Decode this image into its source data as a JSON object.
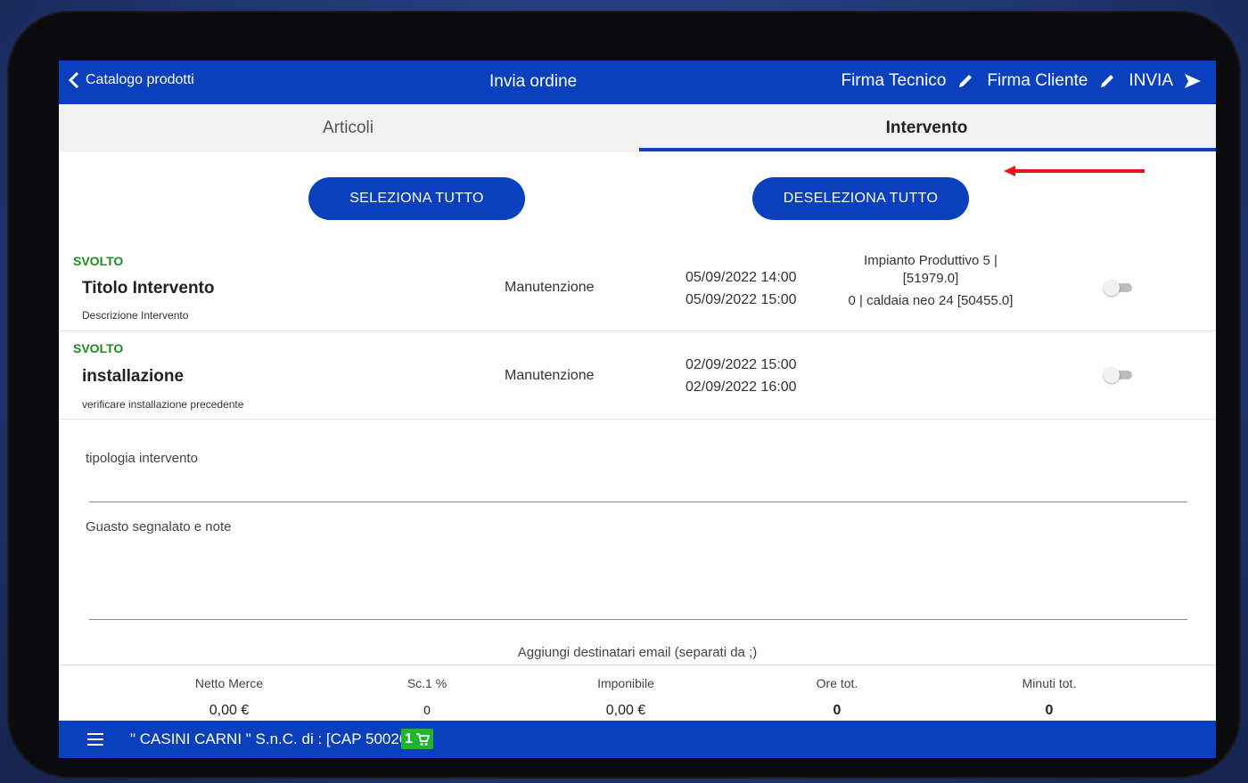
{
  "header": {
    "back_label": "Catalogo prodotti",
    "title": "Invia ordine",
    "firma_tecnico": "Firma Tecnico",
    "firma_cliente": "Firma Cliente",
    "invia": "INVIA"
  },
  "tabs": [
    {
      "label": "Articoli",
      "active": false
    },
    {
      "label": "Intervento",
      "active": true
    }
  ],
  "buttons": {
    "select_all": "SELEZIONA TUTTO",
    "deselect_all": "DESELEZIONA TUTTO"
  },
  "interventions": [
    {
      "status": "SVOLTO",
      "title": "Titolo Intervento",
      "description": "Descrizione Intervento",
      "type": "Manutenzione",
      "start": "05/09/2022 14:00",
      "end": "05/09/2022 15:00",
      "impianto_line1": "Impianto Produttivo 5 |",
      "impianto_line2": "[51979.0]",
      "impianto_line3": "0 | caldaia neo 24 [50455.0]",
      "selected": false
    },
    {
      "status": "SVOLTO",
      "title": "installazione",
      "description": "verificare installazione precedente",
      "type": "Manutenzione",
      "start": "02/09/2022 15:00",
      "end": "02/09/2022 16:00",
      "selected": false
    }
  ],
  "fields": {
    "tipologia_placeholder": "tipologia intervento",
    "guasto_placeholder": "Guasto segnalato e note",
    "email_placeholder": "Aggiungi destinatari email (separati da ;)"
  },
  "totals": {
    "netto_label": "Netto Merce",
    "netto_value": "0,00 €",
    "sc_label": "Sc.1 %",
    "sc_value": "0",
    "imponibile_label": "Imponibile",
    "imponibile_value": "0,00 €",
    "ore_label": "Ore tot.",
    "ore_value": "0",
    "minuti_label": "Minuti tot.",
    "minuti_value": "0"
  },
  "footer": {
    "client": "\" CASINI CARNI \" S.n.C. di : [CAP 50026]",
    "cart_count": "1"
  },
  "colors": {
    "primary": "#0a3fbd",
    "status_green": "#1e8a1e",
    "cart_green": "#1fb52e",
    "annotation_red": "#e8141c"
  }
}
